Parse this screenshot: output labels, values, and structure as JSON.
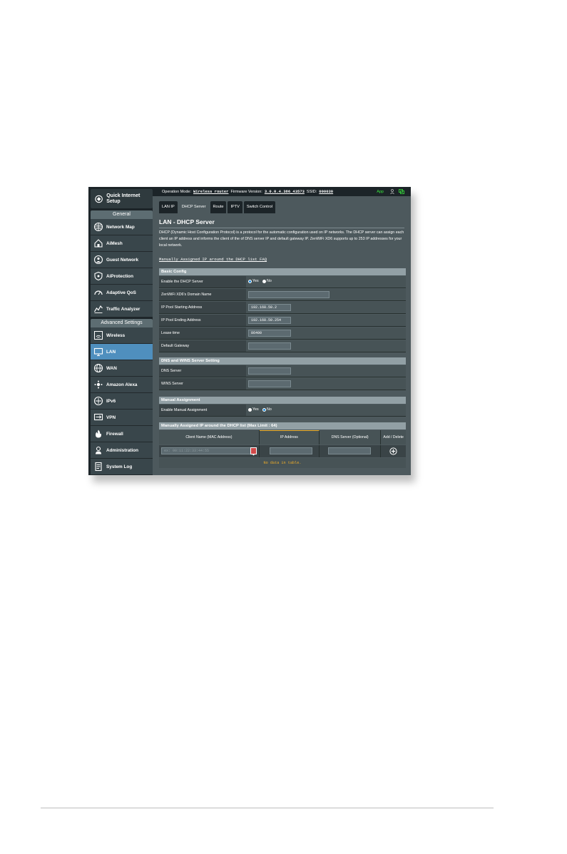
{
  "topbar": {
    "operation_mode_label": "Operation Mode:",
    "operation_mode_value": "Wireless router",
    "firmware_label": "Firmware Version:",
    "firmware_value": "3.0.0.4.386_43573",
    "ssid_label": "SSID:",
    "ssid_value": "000030",
    "app_label": "App"
  },
  "sidebar": {
    "quick_setup": "Quick Internet Setup",
    "general_header": "General",
    "general_items": [
      "Network Map",
      "AiMesh",
      "Guest Network",
      "AiProtection",
      "Adaptive QoS",
      "Traffic Analyzer"
    ],
    "advanced_header": "Advanced Settings",
    "advanced_items": [
      "Wireless",
      "LAN",
      "WAN",
      "Amazon Alexa",
      "IPv6",
      "VPN",
      "Firewall",
      "Administration",
      "System Log"
    ]
  },
  "tabs": [
    "LAN IP",
    "DHCP Server",
    "Route",
    "IPTV",
    "Switch Control"
  ],
  "page": {
    "title": "LAN - DHCP Server",
    "description": "DHCP (Dynamic Host Configuration Protocol) is a protocol for the automatic configuration used on IP networks. The DHCP server can assign each client an IP address and informs the client of the of DNS server IP and default gateway IP. ZenWiFi XD6 supports up to 253 IP addresses for your local network.",
    "faq_link": "Manually Assigned IP around the DHCP list FAQ"
  },
  "basic_config": {
    "header": "Basic Config",
    "enable_label": "Enable the DHCP Server",
    "yes": "Yes",
    "no": "No",
    "domain_label": "ZenWiFi XD6's Domain Name",
    "domain_value": "",
    "start_label": "IP Pool Starting Address",
    "start_value": "192.168.50.2",
    "end_label": "IP Pool Ending Address",
    "end_value": "192.168.50.254",
    "lease_label": "Lease time",
    "lease_value": "86400",
    "gateway_label": "Default Gateway",
    "gateway_value": ""
  },
  "dns_wins": {
    "header": "DNS and WINS Server Setting",
    "dns_label": "DNS Server",
    "wins_label": "WINS Server"
  },
  "manual": {
    "header": "Manual Assignment",
    "enable_label": "Enable Manual Assignment",
    "yes": "Yes",
    "no": "No"
  },
  "manual_list": {
    "header": "Manually Assigned IP around the DHCP list (Max Limit : 64)",
    "columns": [
      "Client Name (MAC Address)",
      "IP Address",
      "DNS Server (Optional)",
      "Add / Delete"
    ],
    "client_placeholder": "ex: 00:11:22:33:44:55",
    "empty_text": "No data in table."
  }
}
